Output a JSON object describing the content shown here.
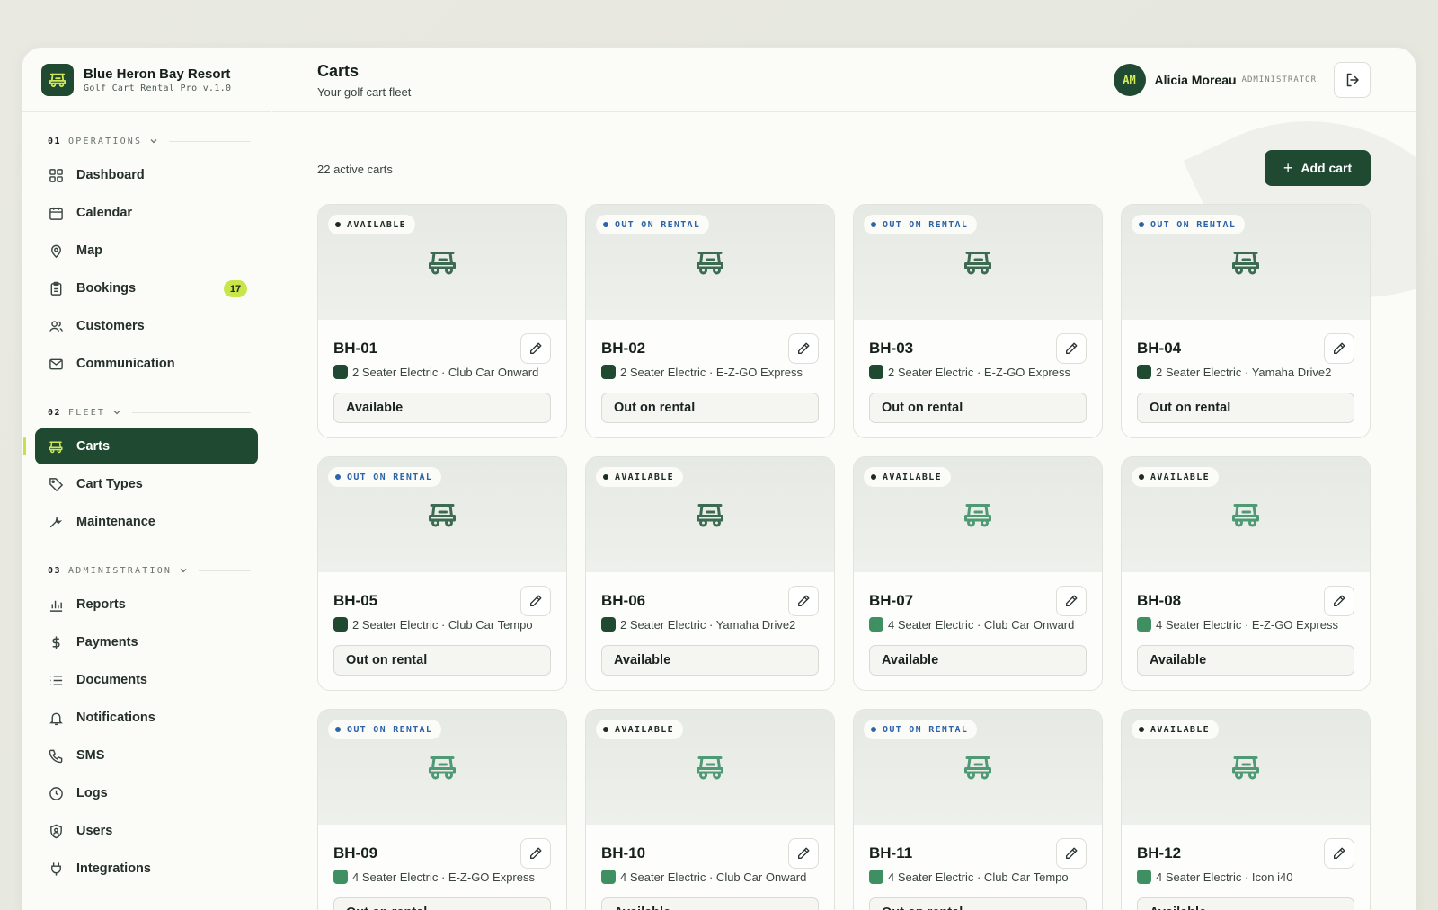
{
  "brand": {
    "name": "Blue Heron Bay Resort",
    "subtitle": "Golf Cart Rental Pro v.1.0",
    "logo_icon": "golf-cart-icon",
    "color": "#1f4a31"
  },
  "sidebar": {
    "sections": [
      {
        "num": "01",
        "title": "OPERATIONS",
        "items": [
          {
            "label": "Dashboard",
            "icon": "grid-icon"
          },
          {
            "label": "Calendar",
            "icon": "calendar-icon"
          },
          {
            "label": "Map",
            "icon": "map-pin-icon"
          },
          {
            "label": "Bookings",
            "icon": "clipboard-icon",
            "badge": "17"
          },
          {
            "label": "Customers",
            "icon": "users-icon"
          },
          {
            "label": "Communication",
            "icon": "mail-icon"
          }
        ]
      },
      {
        "num": "02",
        "title": "FLEET",
        "items": [
          {
            "label": "Carts",
            "icon": "golf-cart-icon",
            "active": true
          },
          {
            "label": "Cart Types",
            "icon": "tag-icon"
          },
          {
            "label": "Maintenance",
            "icon": "wrench-icon"
          }
        ]
      },
      {
        "num": "03",
        "title": "ADMINISTRATION",
        "items": [
          {
            "label": "Reports",
            "icon": "bar-chart-icon"
          },
          {
            "label": "Payments",
            "icon": "dollar-icon"
          },
          {
            "label": "Documents",
            "icon": "list-icon"
          },
          {
            "label": "Notifications",
            "icon": "bell-icon"
          },
          {
            "label": "SMS",
            "icon": "phone-icon"
          },
          {
            "label": "Logs",
            "icon": "clock-icon"
          },
          {
            "label": "Users",
            "icon": "shield-user-icon"
          },
          {
            "label": "Integrations",
            "icon": "plug-icon"
          }
        ]
      }
    ]
  },
  "header": {
    "title": "Carts",
    "subtitle": "Your golf cart fleet",
    "user": {
      "initials": "AM",
      "name": "Alicia Moreau",
      "role": "ADMINISTRATOR"
    },
    "logout_icon": "logout-icon"
  },
  "toolbar": {
    "count_text": "22 active carts",
    "add_label": "Add cart"
  },
  "colors": {
    "accent": "#1f4a31",
    "badge": "#c8e64a",
    "status_out": "#2d64a8",
    "swatch_dark": "#1f4a31",
    "swatch_light": "#3f8f63"
  },
  "carts": [
    {
      "code": "BH-01",
      "pill": "AVAILABLE",
      "desc": "2 Seater Electric · Club Car Onward",
      "status": "Available",
      "swatch": "#1f4a31",
      "icon_color": "#3d6b52"
    },
    {
      "code": "BH-02",
      "pill": "OUT ON RENTAL",
      "desc": "2 Seater Electric · E-Z-GO Express",
      "status": "Out on rental",
      "swatch": "#1f4a31",
      "icon_color": "#3d6b52"
    },
    {
      "code": "BH-03",
      "pill": "OUT ON RENTAL",
      "desc": "2 Seater Electric · E-Z-GO Express",
      "status": "Out on rental",
      "swatch": "#1f4a31",
      "icon_color": "#3d6b52"
    },
    {
      "code": "BH-04",
      "pill": "OUT ON RENTAL",
      "desc": "2 Seater Electric · Yamaha Drive2",
      "status": "Out on rental",
      "swatch": "#1f4a31",
      "icon_color": "#3d6b52"
    },
    {
      "code": "BH-05",
      "pill": "OUT ON RENTAL",
      "desc": "2 Seater Electric · Club Car Tempo",
      "status": "Out on rental",
      "swatch": "#1f4a31",
      "icon_color": "#3d6b52"
    },
    {
      "code": "BH-06",
      "pill": "AVAILABLE",
      "desc": "2 Seater Electric · Yamaha Drive2",
      "status": "Available",
      "swatch": "#1f4a31",
      "icon_color": "#3d6b52"
    },
    {
      "code": "BH-07",
      "pill": "AVAILABLE",
      "desc": "4 Seater Electric · Club Car Onward",
      "status": "Available",
      "swatch": "#3f8f63",
      "icon_color": "#4f9a74"
    },
    {
      "code": "BH-08",
      "pill": "AVAILABLE",
      "desc": "4 Seater Electric · E-Z-GO Express",
      "status": "Available",
      "swatch": "#3f8f63",
      "icon_color": "#4f9a74"
    },
    {
      "code": "BH-09",
      "pill": "OUT ON RENTAL",
      "desc": "4 Seater Electric · E-Z-GO Express",
      "status": "Out on rental",
      "swatch": "#3f8f63",
      "icon_color": "#4f9a74"
    },
    {
      "code": "BH-10",
      "pill": "AVAILABLE",
      "desc": "4 Seater Electric · Club Car Onward",
      "status": "Available",
      "swatch": "#3f8f63",
      "icon_color": "#4f9a74"
    },
    {
      "code": "BH-11",
      "pill": "OUT ON RENTAL",
      "desc": "4 Seater Electric · Club Car Tempo",
      "status": "Out on rental",
      "swatch": "#3f8f63",
      "icon_color": "#4f9a74"
    },
    {
      "code": "BH-12",
      "pill": "AVAILABLE",
      "desc": "4 Seater Electric · Icon i40",
      "status": "Available",
      "swatch": "#3f8f63",
      "icon_color": "#4f9a74"
    }
  ]
}
